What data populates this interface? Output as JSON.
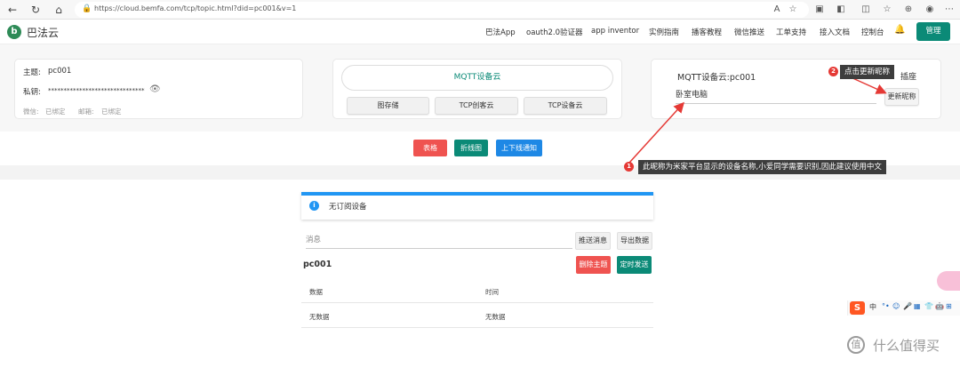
{
  "browser": {
    "url": "https://cloud.bemfa.com/tcp/topic.html?did=pc001&v=1",
    "icons": [
      "back-icon",
      "refresh-icon",
      "home-icon",
      "lock-icon",
      "read-aloud-icon",
      "favorite-icon",
      "extension-icon",
      "split-icon",
      "favorites-bar-icon",
      "collections-icon",
      "profile-icon",
      "menu-icon"
    ]
  },
  "header": {
    "logo_glyph": "b",
    "brand": "巴法云",
    "nav": [
      "巴法App",
      "oauth2.0验证器",
      "app inventor",
      "实例指南",
      "播客教程",
      "微信推送",
      "工单支持",
      "接入文档",
      "控制台"
    ],
    "manage_label": "管理"
  },
  "topic_card": {
    "topic_label": "主题:",
    "topic_value": "pc001",
    "key_label": "私钥:",
    "key_value": "*******************************",
    "wechat_label": "微信:",
    "wechat_status": "已绑定",
    "email_label": "邮箱:",
    "email_status": "已绑定"
  },
  "cloud_card": {
    "pill_label": "MQTT设备云",
    "buttons": [
      "图存储",
      "TCP创客云",
      "TCP设备云"
    ]
  },
  "nickname_card": {
    "title": "MQTT设备云:pc001",
    "suffix": "插座",
    "input_value": "卧室电脑",
    "update_button": "更新昵称"
  },
  "actions": {
    "table_button": "表格",
    "chart_button": "折线图",
    "notify_button": "上下线通知"
  },
  "annotations": [
    {
      "num": "2",
      "text": "点击更新昵称"
    },
    {
      "num": "1",
      "text": "此昵称为米家平台显示的设备名称,小爱同学需要识别,因此建议使用中文"
    }
  ],
  "info": {
    "text": "无订阅设备",
    "icon_glyph": "i"
  },
  "message": {
    "placeholder": "消息",
    "send_button": "推送消息",
    "export_button": "导出数据"
  },
  "topic_panel": {
    "name": "pc001",
    "delete_button": "删除主题",
    "timer_button": "定时发送"
  },
  "table": {
    "headers": [
      "数据",
      "时间"
    ],
    "rows": [
      [
        "无数据",
        "无数据"
      ]
    ]
  },
  "ime": {
    "logo": "S",
    "lang": "中",
    "items": [
      "°•",
      "☺",
      "🎤",
      "▦",
      "👕",
      "🤖",
      "⊞"
    ]
  },
  "watermark": {
    "glyph": "值",
    "text": "什么值得买"
  },
  "colors": {
    "accent": "#0b8a77",
    "red": "#ef5350",
    "blue": "#1e88e5",
    "info_blue": "#2196f3",
    "annotation": "#e53935"
  }
}
